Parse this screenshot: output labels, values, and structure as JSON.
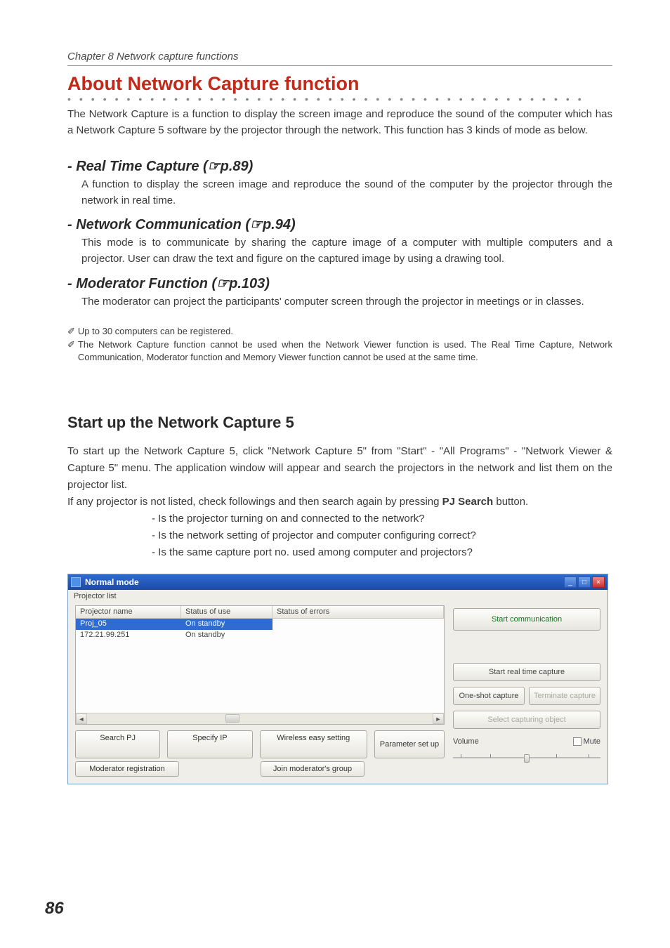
{
  "chapter": "Chapter 8 Network capture functions",
  "title": "About Network Capture function",
  "intro": "The Network Capture is a function to display the screen image and reproduce the sound of the computer which has a Network Capture 5 software by the projector through the network. This function has 3 kinds of mode as below.",
  "sections": [
    {
      "heading": "- Real Time Capture (☞p.89)",
      "body": " A function to display the screen image and reproduce the sound of the computer by the projector through the network in real time."
    },
    {
      "heading": "- Network Communication (☞p.94)",
      "body": "This mode is to communicate by sharing the capture image of a computer with multiple computers and a projector. User can draw the text and figure on the captured image by using a drawing tool."
    },
    {
      "heading": "- Moderator Function (☞p.103)",
      "body": "The moderator can project the participants' computer screen through the projector in meetings or in classes."
    }
  ],
  "notes": [
    "Up to 30 computers can be registered.",
    "The Network  Capture function cannot be used when the Network Viewer function is used. The Real Time Capture, Network Communication, Moderator function and Memory Viewer function cannot be used at the same time."
  ],
  "start": {
    "title": "Start up the Network Capture 5",
    "body1": "To start up the Network Capture 5, click \"Network Capture 5\" from \"Start\" - \"All Programs\" - \"Network Viewer & Capture 5\" menu. The application window will appear and search the projectors in the network and list them on the projector list.",
    "body2_pre": "If any projector is not listed, check followings and then search again by pressing ",
    "body2_bold": "PJ Search",
    "body2_post": " button.",
    "checks": [
      "- Is the projector turning on and connected to the network?",
      "- Is the network setting of projector and computer configuring correct?",
      "- Is the same capture port no. used among computer and projectors?"
    ]
  },
  "app": {
    "title": "Normal mode",
    "menu": "Projector list",
    "columns": [
      "Projector name",
      "Status of use",
      "Status of errors"
    ],
    "rows": [
      {
        "name": "Proj_05",
        "status": "On standby",
        "err": ""
      },
      {
        "name": "172.21.99.251",
        "status": "On standby",
        "err": ""
      }
    ],
    "buttons": {
      "search_pj": "Search PJ",
      "specify_ip": "Specify IP",
      "wireless_easy": "Wireless easy setting",
      "moderator_reg": "Moderator registration",
      "join_moderator": "Join moderator's group",
      "parameter_setup": "Parameter set up"
    },
    "right": {
      "start_comm": "Start communication",
      "start_rt": "Start real time capture",
      "one_shot": "One-shot capture",
      "terminate": "Terminate capture",
      "select_obj": "Select capturing object",
      "volume_label": "Volume",
      "mute_label": "Mute"
    }
  },
  "page_number": "86"
}
